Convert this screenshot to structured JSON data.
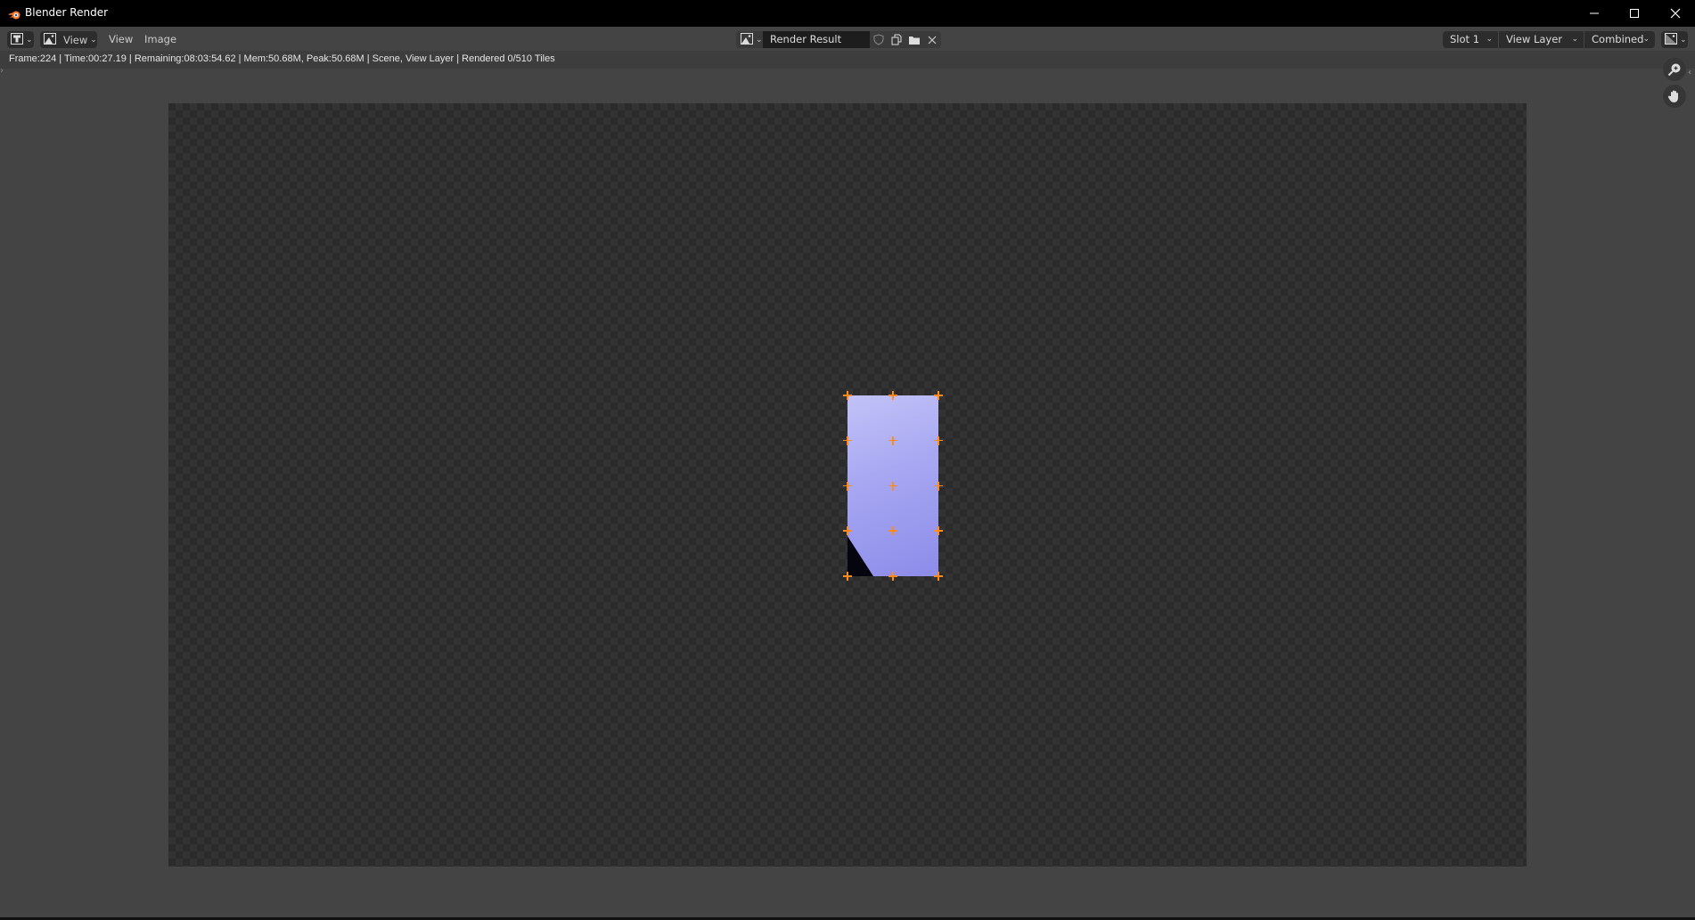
{
  "window": {
    "title": "Blender Render",
    "controls": [
      "minimize",
      "maximize",
      "close"
    ]
  },
  "header": {
    "editor_type_icon": "image-editor-icon",
    "mode_dropdown": {
      "icon": "image-icon",
      "label": "View"
    },
    "menus": [
      {
        "label": "View"
      },
      {
        "label": "Image"
      }
    ],
    "image_browser": {
      "icon": "image-browse-icon",
      "name": "Render Result",
      "actions": [
        {
          "name": "fake-user",
          "icon": "shield-icon"
        },
        {
          "name": "new-image",
          "icon": "duplicate-icon"
        },
        {
          "name": "open-image",
          "icon": "folder-icon"
        },
        {
          "name": "unlink-image",
          "icon": "close-icon"
        }
      ]
    },
    "slot": "Slot 1",
    "view_layer": "View Layer",
    "pass": "Combined",
    "display_channels_icon": "display-channels-icon"
  },
  "info": {
    "frame": "Frame:224",
    "time": "Time:00:27.19",
    "remaining": "Remaining:08:03:54.62",
    "memory": "Mem:50.68M, Peak:50.68M",
    "scene": "Scene, View Layer",
    "progress": "Rendered 0/510 Tiles",
    "line": "Frame:224 | Time:00:27.19 | Remaining:08:03:54.62 | Mem:50.68M, Peak:50.68M | Scene, View Layer | Rendered 0/510 Tiles"
  },
  "render": {
    "tiles_rendered": 0,
    "tiles_total": 510,
    "tile_marker_color": "#ff8a1e",
    "preview_colors": [
      "#c2c2f8",
      "#8c8cea"
    ]
  },
  "navigation": {
    "zoom_tool": "zoom-icon",
    "pan_tool": "hand-icon"
  },
  "colors": {
    "background": "#444444",
    "titlebar": "#000000",
    "checker_dark": "#2b2b2b",
    "checker_light": "#333333"
  }
}
